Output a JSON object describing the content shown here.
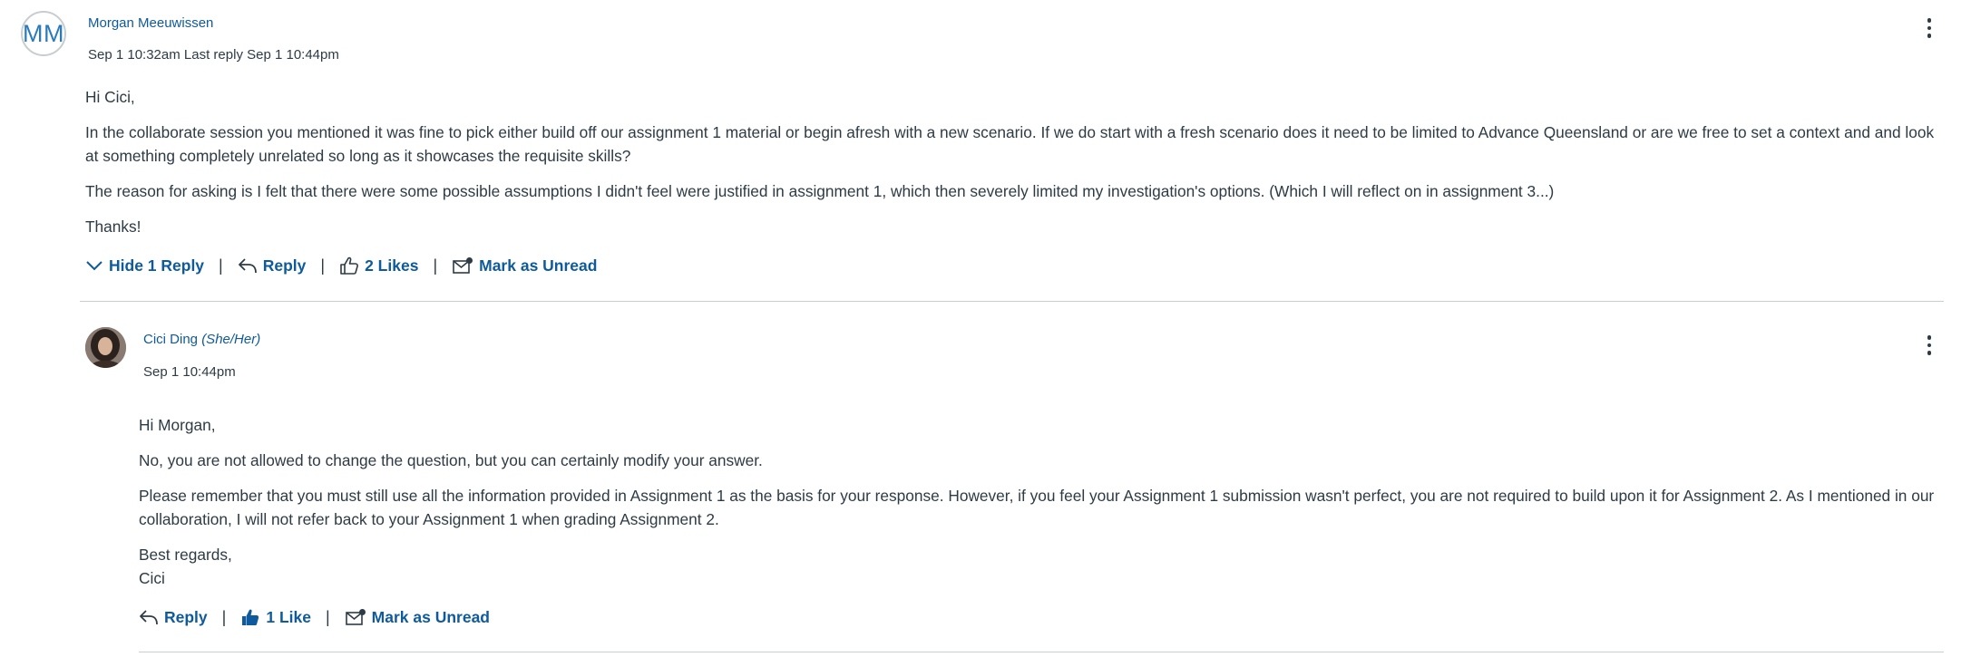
{
  "post": {
    "avatar_initials": "MM",
    "author": "Morgan Meeuwissen",
    "meta": "Sep 1 10:32am  Last reply Sep 1 10:44pm",
    "paragraphs": [
      "Hi Cici,",
      "In the collaborate session you mentioned it was fine to pick either build off our assignment  1 material or begin afresh with a new scenario. If we do start with a fresh scenario does it need to be limited to Advance Queensland or are we free to set a context and and look at something completely unrelated so long as it showcases the requisite skills?",
      "The reason for asking is I felt that there were some possible assumptions I didn't feel were justified in assignment 1, which then severely limited my investigation's options. (Which I will reflect on in assignment 3...)",
      "Thanks!"
    ],
    "actions": {
      "hide_replies": "Hide 1 Reply",
      "reply": "Reply",
      "likes": "2 Likes",
      "mark_unread": "Mark as Unread"
    },
    "more_options_icon": "kebab-menu-icon"
  },
  "reply": {
    "author": "Cici Ding",
    "pronouns": "(She/Her)",
    "meta": "Sep 1 10:44pm",
    "paragraphs": [
      "Hi Morgan,",
      "No, you are not allowed to change the question, but you can certainly modify your answer.",
      "Please remember that you must still use all the information provided in Assignment 1 as the basis for your response. However, if you feel your Assignment 1 submission wasn't perfect, you are not required to build upon it for Assignment 2. As I mentioned in our collaboration, I will not refer back to your Assignment 1 when grading Assignment 2.",
      "Best regards,",
      "Cici"
    ],
    "actions": {
      "reply": "Reply",
      "likes": "1 Like",
      "mark_unread": "Mark as Unread"
    },
    "more_options_icon": "kebab-menu-icon"
  },
  "colors": {
    "link": "#0e5a9c",
    "text": "#2d3b45",
    "divider": "#c7cdd1",
    "avatar_ring": "#c7cdd1"
  }
}
